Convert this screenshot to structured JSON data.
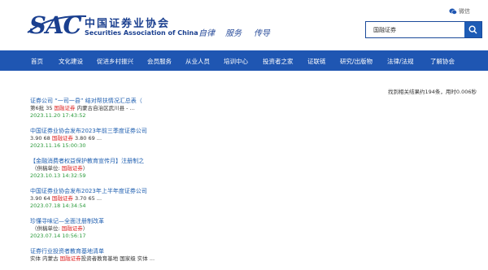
{
  "header": {
    "logo_text": "SAC",
    "logo_cn": "中国证券业协会",
    "logo_en": "Securities Association of China",
    "slogans": [
      "自律",
      "服务",
      "传导"
    ],
    "wechat_label": "微信",
    "search_value": "国融证券",
    "brand_color": "#1a3f8f"
  },
  "nav": {
    "items": [
      "首页",
      "文化建设",
      "促进乡村振兴",
      "会员服务",
      "从业人员",
      "培训中心",
      "投资者之家",
      "证联链",
      "研究/出版物",
      "法律/法规",
      "了解协会"
    ],
    "bg_color": "#1f56b2"
  },
  "results_summary": "找到相关结果约194条，用时0.006秒",
  "results": [
    {
      "title": "证券公司 “一司一县” 结对帮扶情况汇总表（",
      "snippet_pre": "第6批 35 ",
      "snippet_hl": "国融证券",
      "snippet_post": " 内蒙古自治区武川县 - ...",
      "date": "2023.11.20 17:43:52"
    },
    {
      "title": "中国证券业协会发布2023年前三季度证券公司",
      "snippet_pre": "3.90 68 ",
      "snippet_hl": "国融证券",
      "snippet_post": " 3.80 69 ...",
      "date": "2023.11.16 15:00:30"
    },
    {
      "title": "【金融消费者权益保护教育宣传月】注册制之",
      "snippet_pre": "（供稿单位: ",
      "snippet_hl": "国融证券",
      "snippet_post": "）",
      "date": "2023.10.13 14:32:59"
    },
    {
      "title": "中国证券业协会发布2023年上半年度证券公司",
      "snippet_pre": "3.90 64 ",
      "snippet_hl": "国融证券",
      "snippet_post": " 3.70 65 ...",
      "date": "2023.07.18 14:34:54"
    },
    {
      "title": "珍懂寻味记—全面注册制改革",
      "snippet_pre": "（供稿单位: ",
      "snippet_hl": "国融证券",
      "snippet_post": "）",
      "date": "2023.07.14 10:56:17"
    },
    {
      "title": "证券行业投资者教育基地清单",
      "snippet_pre": "实体 内蒙古 ",
      "snippet_hl": "国融证券",
      "snippet_post": "投资者教育基地 国家级 实体 ...",
      "date": ""
    }
  ],
  "colors": {
    "link": "#1f5fb0",
    "highlight": "#dd2222",
    "date": "#2a9a3a"
  }
}
